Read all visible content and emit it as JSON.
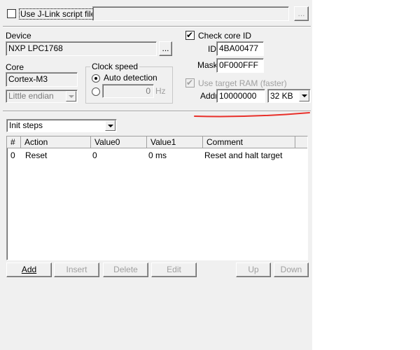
{
  "script": {
    "checkbox_label": "Use J-Link script file",
    "path_value": "",
    "browse_label": "..."
  },
  "device": {
    "label": "Device",
    "value": "NXP LPC1768",
    "browse_label": "..."
  },
  "core": {
    "label": "Core",
    "value": "Cortex-M3",
    "endian_value": "Little endian"
  },
  "clock": {
    "title": "Clock speed",
    "auto_label": "Auto detection",
    "manual_value": "0",
    "unit": "Hz"
  },
  "core_id": {
    "checkbox_label": "Check core ID",
    "id_label": "ID",
    "id_value": "4BA00477",
    "mask_label": "Mask",
    "mask_value": "0F000FFF"
  },
  "target_ram": {
    "checkbox_label": "Use target RAM (faster)",
    "addr_label": "Addr",
    "addr_value": "10000000",
    "size_value": "32 KB"
  },
  "steps": {
    "selector_value": "Init steps",
    "columns": [
      "#",
      "Action",
      "Value0",
      "Value1",
      "Comment"
    ],
    "rows": [
      {
        "num": "0",
        "action": "Reset",
        "value0": "0",
        "value1": "0 ms",
        "comment": "Reset and halt target"
      }
    ]
  },
  "buttons": {
    "add": "Add",
    "insert": "Insert",
    "delete": "Delete",
    "edit": "Edit",
    "up": "Up",
    "down": "Down"
  },
  "colors": {
    "annotation_line": "#e8302a",
    "disabled_text": "#a0a0a0",
    "panel_bg": "#f0f0f0"
  }
}
